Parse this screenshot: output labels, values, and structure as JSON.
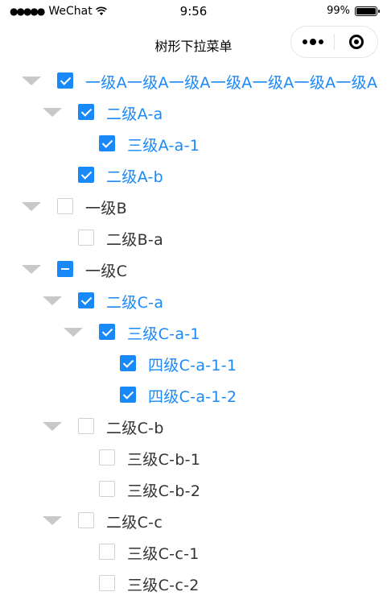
{
  "status_bar": {
    "signal": "●●●●●",
    "carrier": "WeChat",
    "time": "9:56",
    "battery": "99%"
  },
  "nav": {
    "title": "树形下拉菜单"
  },
  "colors": {
    "accent": "#1989fa",
    "text": "#333333",
    "toggle": "#c8c8c8"
  },
  "tree": [
    {
      "level": 1,
      "expanded": true,
      "check": "checked",
      "label": "一级A一级A一级A一级A一级A一级A一级A"
    },
    {
      "level": 2,
      "expanded": true,
      "check": "checked",
      "label": "二级A-a"
    },
    {
      "level": 3,
      "expanded": null,
      "check": "checked",
      "label": "三级A-a-1"
    },
    {
      "level": 2,
      "expanded": null,
      "check": "checked",
      "label": "二级A-b"
    },
    {
      "level": 1,
      "expanded": true,
      "check": "unchecked",
      "label": "一级B"
    },
    {
      "level": 2,
      "expanded": null,
      "check": "unchecked",
      "label": "二级B-a"
    },
    {
      "level": 1,
      "expanded": true,
      "check": "partial",
      "label": "一级C"
    },
    {
      "level": 2,
      "expanded": true,
      "check": "checked",
      "label": "二级C-a"
    },
    {
      "level": 3,
      "expanded": true,
      "check": "checked",
      "label": "三级C-a-1"
    },
    {
      "level": 4,
      "expanded": null,
      "check": "checked",
      "label": "四级C-a-1-1"
    },
    {
      "level": 4,
      "expanded": null,
      "check": "checked",
      "label": "四级C-a-1-2"
    },
    {
      "level": 2,
      "expanded": true,
      "check": "unchecked",
      "label": "二级C-b"
    },
    {
      "level": 3,
      "expanded": null,
      "check": "unchecked",
      "label": "三级C-b-1"
    },
    {
      "level": 3,
      "expanded": null,
      "check": "unchecked",
      "label": "三级C-b-2"
    },
    {
      "level": 2,
      "expanded": true,
      "check": "unchecked",
      "label": "二级C-c"
    },
    {
      "level": 3,
      "expanded": null,
      "check": "unchecked",
      "label": "三级C-c-1"
    },
    {
      "level": 3,
      "expanded": null,
      "check": "unchecked",
      "label": "三级C-c-2"
    }
  ]
}
